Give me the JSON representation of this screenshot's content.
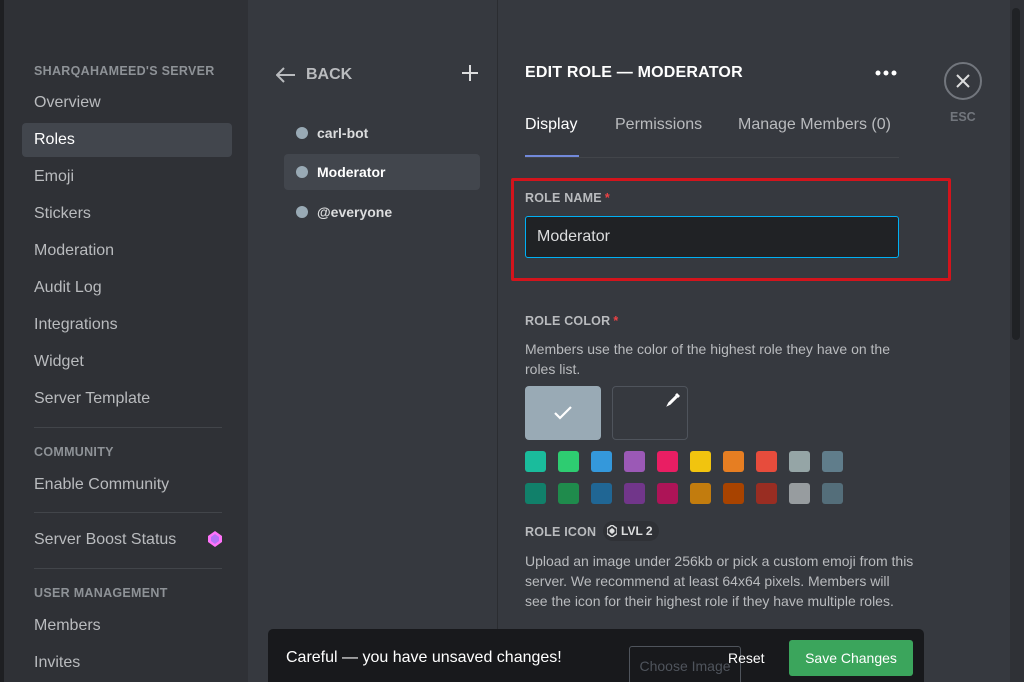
{
  "sidebar": {
    "server_header": "SHARQAHAMEED'S SERVER",
    "items": [
      {
        "label": "Overview"
      },
      {
        "label": "Roles"
      },
      {
        "label": "Emoji"
      },
      {
        "label": "Stickers"
      },
      {
        "label": "Moderation"
      },
      {
        "label": "Audit Log"
      },
      {
        "label": "Integrations"
      },
      {
        "label": "Widget"
      },
      {
        "label": "Server Template"
      }
    ],
    "community_header": "COMMUNITY",
    "enable_community": "Enable Community",
    "boost_status": "Server Boost Status",
    "user_mgmt_header": "USER MANAGEMENT",
    "members": "Members",
    "invites": "Invites"
  },
  "roles_panel": {
    "back_label": "BACK",
    "roles": [
      {
        "name": "carl-bot"
      },
      {
        "name": "Moderator"
      },
      {
        "name": "@everyone"
      }
    ]
  },
  "edit": {
    "title": "EDIT ROLE — MODERATOR",
    "tabs": [
      "Display",
      "Permissions",
      "Manage Members (0)"
    ],
    "role_name_label": "ROLE NAME",
    "role_name_value": "Moderator",
    "role_color_label": "ROLE COLOR",
    "role_color_desc": "Members use the color of the highest role they have on the roles list.",
    "default_color": "#99aab5",
    "palette_row1": [
      "#1abc9c",
      "#2ecc71",
      "#3498db",
      "#9b59b6",
      "#e91e63",
      "#f1c40f",
      "#e67e22",
      "#e74c3c",
      "#95a5a6",
      "#607d8b"
    ],
    "palette_row2": [
      "#11806a",
      "#1f8b4c",
      "#206694",
      "#71368a",
      "#ad1457",
      "#c27c0e",
      "#a84300",
      "#992d22",
      "#979c9f",
      "#546e7a"
    ],
    "role_icon_label": "ROLE ICON",
    "lvl_badge": "LVL 2",
    "role_icon_desc": "Upload an image under 256kb or pick a custom emoji from this server. We recommend at least 64x64 pixels. Members will see the icon for their highest role if they have multiple roles.",
    "required_mark": "*"
  },
  "close": {
    "esc_label": "ESC"
  },
  "notice": {
    "text": "Careful — you have unsaved changes!",
    "choose_image": "Choose Image",
    "reset": "Reset",
    "save": "Save Changes"
  }
}
